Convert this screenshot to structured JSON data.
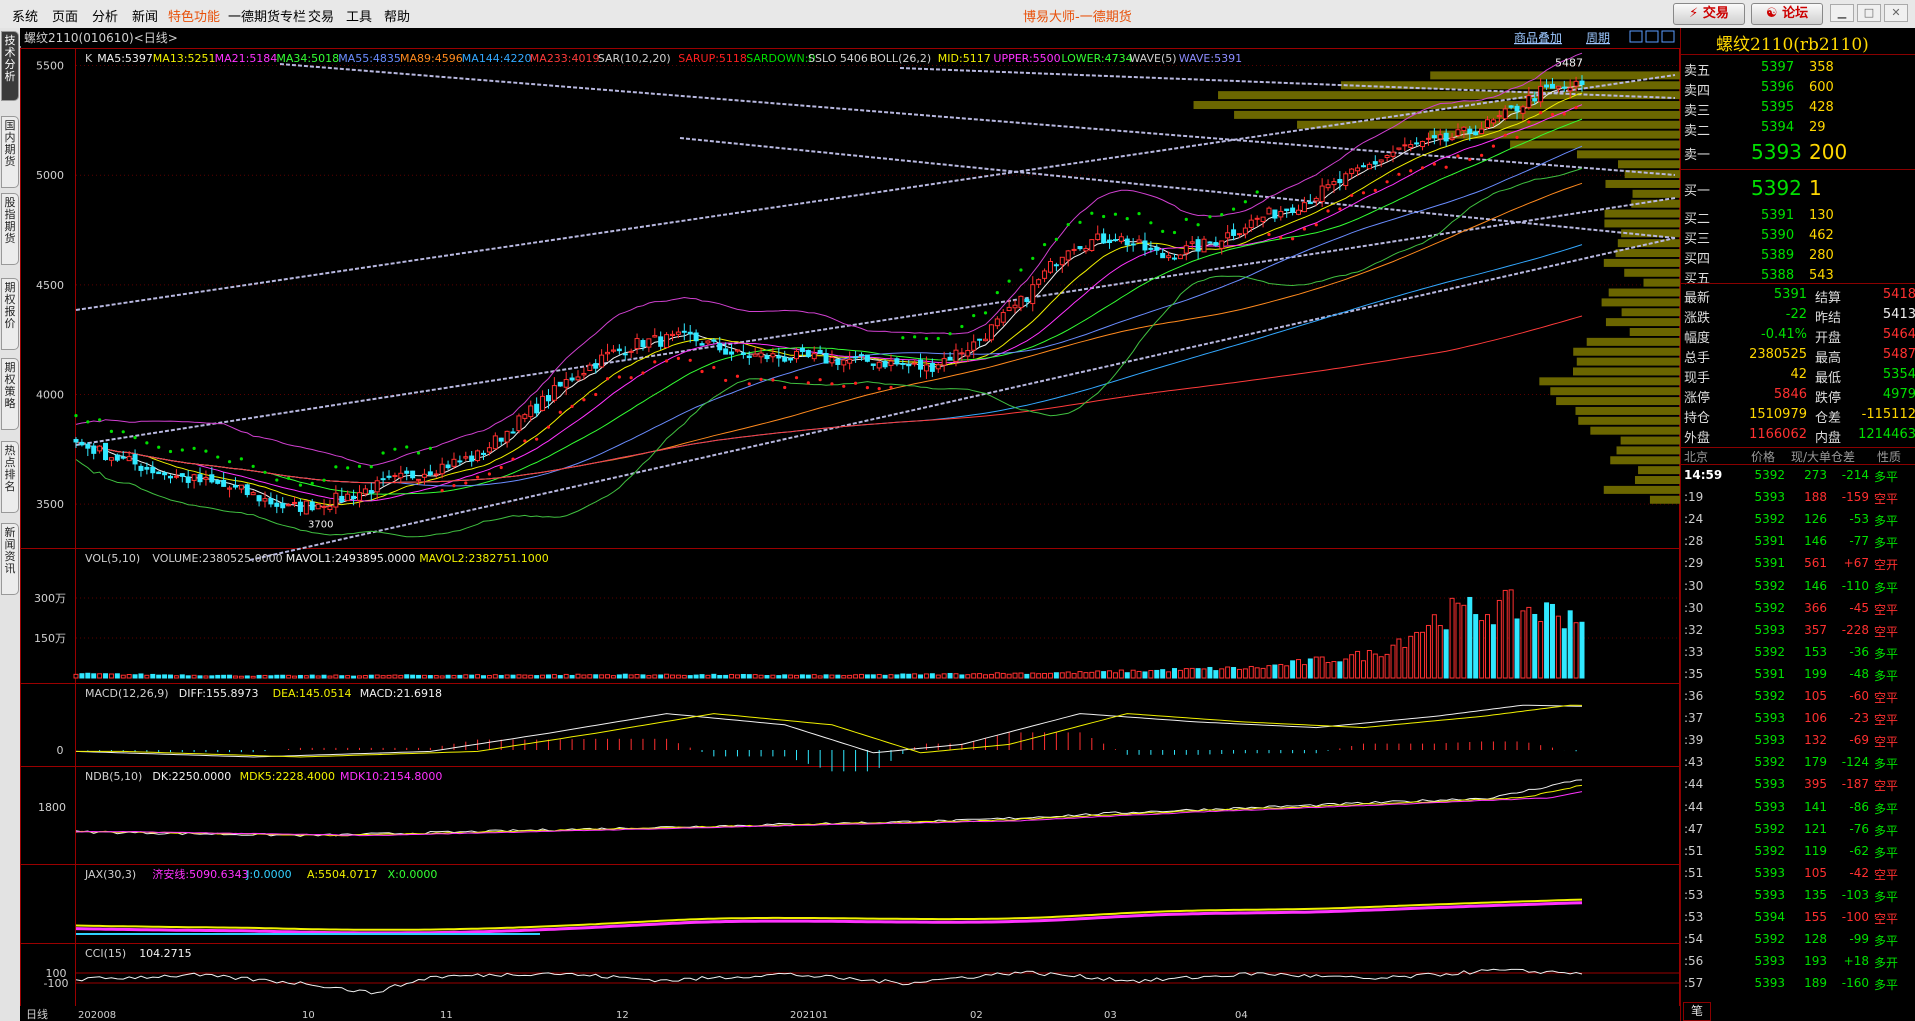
{
  "menu": {
    "items": [
      "系统",
      "页面",
      "分析",
      "新闻",
      "特色功能",
      "一德期货专栏",
      "交易",
      "工具",
      "帮助"
    ],
    "title": "博易大师-一德期货",
    "trade_button": "交易",
    "forum_button": "论坛"
  },
  "left_tabs": [
    "技术分析",
    "国内期货",
    "股指期货",
    "期权报价",
    "期权策略",
    "热点排名",
    "新闻资讯"
  ],
  "chart_header": {
    "instrument": "螺纹2110(010610)<日线>",
    "links": [
      "商品叠加",
      "周期"
    ]
  },
  "main_legend": [
    {
      "text": "K",
      "color": "#d0d0d0"
    },
    {
      "text": "MA5:5397",
      "color": "#f0f0f0"
    },
    {
      "text": "MA13:5251",
      "color": "#f0f000"
    },
    {
      "text": "MA21:5184",
      "color": "#ff33ff"
    },
    {
      "text": "MA34:5018",
      "color": "#33ff33"
    },
    {
      "text": "MA55:4835",
      "color": "#6a8cff"
    },
    {
      "text": "MA89:4596",
      "color": "#ff8a1e"
    },
    {
      "text": "MA144:4220",
      "color": "#33a8ff"
    },
    {
      "text": "MA233:4019",
      "color": "#ff3b3b"
    },
    {
      "text": "SAR(10,2,20)",
      "color": "#d0d0d0"
    },
    {
      "text": "SARUP:5118",
      "color": "#ff2020"
    },
    {
      "text": "SARDOWN:0",
      "color": "#00e000"
    },
    {
      "text": "SSLO 5406",
      "color": "#d0d0d0"
    },
    {
      "text": "BOLL(26,2)",
      "color": "#d0d0d0"
    },
    {
      "text": "MID:5117",
      "color": "#f0f000"
    },
    {
      "text": "UPPER:5500",
      "color": "#ff33ff"
    },
    {
      "text": "LOWER:4734",
      "color": "#33ff33"
    },
    {
      "text": "WAVE(5)",
      "color": "#d0d0d0"
    },
    {
      "text": "WAVE:5391",
      "color": "#8c8cff"
    }
  ],
  "price_axis": [
    "5500",
    "5000",
    "4500",
    "4000",
    "3500"
  ],
  "annotations": {
    "high_label": "5487",
    "low_label": "3700"
  },
  "sub_panels": {
    "vol": {
      "legend": [
        {
          "text": "VOL(5,10)",
          "color": "#d0d0d0"
        },
        {
          "text": "VOLUME:2380525.0000",
          "color": "#d0d0d0"
        },
        {
          "text": "MAVOL1:2493895.0000",
          "color": "#f0f0f0"
        },
        {
          "text": "MAVOL2:2382751.1000",
          "color": "#f0f000"
        }
      ],
      "axis": [
        "300万",
        "150万"
      ]
    },
    "macd": {
      "legend": [
        {
          "text": "MACD(12,26,9)",
          "color": "#d0d0d0"
        },
        {
          "text": "DIFF:155.8973",
          "color": "#f0f0f0"
        },
        {
          "text": "DEA:145.0514",
          "color": "#f0f000"
        },
        {
          "text": "MACD:21.6918",
          "color": "#f0f0f0"
        }
      ],
      "axis": [
        "0"
      ]
    },
    "ndb": {
      "legend": [
        {
          "text": "NDB(5,10)",
          "color": "#d0d0d0"
        },
        {
          "text": "DK:2250.0000",
          "color": "#f0f0f0"
        },
        {
          "text": "MDK5:2228.4000",
          "color": "#f0f000"
        },
        {
          "text": "MDK10:2154.8000",
          "color": "#ff33ff"
        }
      ],
      "axis": [
        "1800"
      ]
    },
    "jax": {
      "legend": [
        {
          "text": "JAX(30,3)",
          "color": "#d0d0d0"
        },
        {
          "text": "济安线:5090.6343",
          "color": "#ff33ff"
        },
        {
          "text": "J:0.0000",
          "color": "#33d0ff"
        },
        {
          "text": "A:5504.0717",
          "color": "#f0f000"
        },
        {
          "text": "X:0.0000",
          "color": "#33ff33"
        }
      ],
      "axis": []
    },
    "cci": {
      "legend": [
        {
          "text": "CCI(15)",
          "color": "#d0d0d0"
        },
        {
          "text": "104.2715",
          "color": "#f0f0f0"
        }
      ],
      "axis": [
        "100",
        "-100"
      ]
    }
  },
  "time_axis": {
    "label": "日线",
    "ticks": [
      "202008",
      "10",
      "11",
      "12",
      "202101",
      "02",
      "03",
      "04"
    ]
  },
  "right_panel": {
    "title": "螺纹2110(rb2110)",
    "asks": [
      {
        "label": "卖五",
        "price": "5397",
        "vol": "358"
      },
      {
        "label": "卖四",
        "price": "5396",
        "vol": "600"
      },
      {
        "label": "卖三",
        "price": "5395",
        "vol": "428"
      },
      {
        "label": "卖二",
        "price": "5394",
        "vol": "29"
      },
      {
        "label": "卖一",
        "price": "5393",
        "vol": "200"
      }
    ],
    "bids": [
      {
        "label": "买一",
        "price": "5392",
        "vol": "1"
      },
      {
        "label": "买二",
        "price": "5391",
        "vol": "130"
      },
      {
        "label": "买三",
        "price": "5390",
        "vol": "462"
      },
      {
        "label": "买四",
        "price": "5389",
        "vol": "280"
      },
      {
        "label": "买五",
        "price": "5388",
        "vol": "543"
      }
    ],
    "quote": [
      {
        "l1": "最新",
        "v1": "5391",
        "c1": "#00e000",
        "l2": "结算",
        "v2": "5418",
        "c2": "#ff3030"
      },
      {
        "l1": "涨跌",
        "v1": "-22",
        "c1": "#00e000",
        "l2": "昨结",
        "v2": "5413",
        "c2": "#f0f0f0"
      },
      {
        "l1": "幅度",
        "v1": "-0.41%",
        "c1": "#00e000",
        "l2": "开盘",
        "v2": "5464",
        "c2": "#ff3030"
      },
      {
        "l1": "总手",
        "v1": "2380525",
        "c1": "#ffd700",
        "l2": "最高",
        "v2": "5487",
        "c2": "#ff3030"
      },
      {
        "l1": "现手",
        "v1": "42",
        "c1": "#ffd700",
        "l2": "最低",
        "v2": "5354",
        "c2": "#00e000"
      },
      {
        "l1": "涨停",
        "v1": "5846",
        "c1": "#ff3030",
        "l2": "跌停",
        "v2": "4979",
        "c2": "#00e000"
      },
      {
        "l1": "持仓",
        "v1": "1510979",
        "c1": "#ffd700",
        "l2": "仓差",
        "v2": "-115112",
        "c2": "#ffd700"
      },
      {
        "l1": "外盘",
        "v1": "1166062",
        "c1": "#ff3030",
        "l2": "内盘",
        "v2": "1214463",
        "c2": "#00e000"
      }
    ],
    "ticks_header": [
      "北京",
      "价格",
      "现/大单",
      "仓差",
      "性质"
    ],
    "ticks": [
      {
        "t": "14:59",
        "p": "5392",
        "v": "273",
        "d": "-214",
        "n": "多平"
      },
      {
        "t": ":19",
        "p": "5393",
        "v": "188",
        "d": "-159",
        "n": "空平"
      },
      {
        "t": ":24",
        "p": "5392",
        "v": "126",
        "d": "-53",
        "n": "多平"
      },
      {
        "t": ":28",
        "p": "5391",
        "v": "146",
        "d": "-77",
        "n": "多平"
      },
      {
        "t": ":29",
        "p": "5391",
        "v": "561",
        "d": "+67",
        "n": "空开"
      },
      {
        "t": ":30",
        "p": "5392",
        "v": "146",
        "d": "-110",
        "n": "多平"
      },
      {
        "t": ":30",
        "p": "5392",
        "v": "366",
        "d": "-45",
        "n": "空平"
      },
      {
        "t": ":32",
        "p": "5393",
        "v": "357",
        "d": "-228",
        "n": "空平"
      },
      {
        "t": ":33",
        "p": "5392",
        "v": "153",
        "d": "-36",
        "n": "多平"
      },
      {
        "t": ":35",
        "p": "5391",
        "v": "199",
        "d": "-48",
        "n": "多平"
      },
      {
        "t": ":36",
        "p": "5392",
        "v": "105",
        "d": "-60",
        "n": "空平"
      },
      {
        "t": ":37",
        "p": "5393",
        "v": "106",
        "d": "-23",
        "n": "空平"
      },
      {
        "t": ":39",
        "p": "5393",
        "v": "132",
        "d": "-69",
        "n": "空平"
      },
      {
        "t": ":43",
        "p": "5392",
        "v": "179",
        "d": "-124",
        "n": "多平"
      },
      {
        "t": ":44",
        "p": "5393",
        "v": "395",
        "d": "-187",
        "n": "空平"
      },
      {
        "t": ":44",
        "p": "5393",
        "v": "141",
        "d": "-86",
        "n": "多平"
      },
      {
        "t": ":47",
        "p": "5392",
        "v": "121",
        "d": "-76",
        "n": "多平"
      },
      {
        "t": ":51",
        "p": "5392",
        "v": "119",
        "d": "-62",
        "n": "多平"
      },
      {
        "t": ":51",
        "p": "5393",
        "v": "105",
        "d": "-42",
        "n": "空平"
      },
      {
        "t": ":53",
        "p": "5393",
        "v": "135",
        "d": "-103",
        "n": "多平"
      },
      {
        "t": ":53",
        "p": "5394",
        "v": "155",
        "d": "-100",
        "n": "空平"
      },
      {
        "t": ":54",
        "p": "5392",
        "v": "128",
        "d": "-99",
        "n": "多平"
      },
      {
        "t": ":56",
        "p": "5393",
        "v": "193",
        "d": "+18",
        "n": "多开"
      },
      {
        "t": ":57",
        "p": "5393",
        "v": "189",
        "d": "-160",
        "n": "多平"
      }
    ],
    "bottom_tab": "笔"
  },
  "chart_data": {
    "type": "candlestick",
    "ylim": [
      3300,
      5580
    ],
    "x_ticks": [
      "202008",
      "10",
      "11",
      "12",
      "202101",
      "02",
      "03",
      "04"
    ],
    "anchors": [
      [
        0,
        3780
      ],
      [
        8,
        3700
      ],
      [
        16,
        3630
      ],
      [
        22,
        3600
      ],
      [
        28,
        3560
      ],
      [
        36,
        3480
      ],
      [
        44,
        3520
      ],
      [
        52,
        3590
      ],
      [
        60,
        3660
      ],
      [
        68,
        3720
      ],
      [
        76,
        3900
      ],
      [
        84,
        4080
      ],
      [
        90,
        4180
      ],
      [
        96,
        4240
      ],
      [
        104,
        4260
      ],
      [
        112,
        4180
      ],
      [
        120,
        4170
      ],
      [
        128,
        4160
      ],
      [
        136,
        4150
      ],
      [
        144,
        4120
      ],
      [
        152,
        4230
      ],
      [
        160,
        4420
      ],
      [
        168,
        4680
      ],
      [
        176,
        4720
      ],
      [
        184,
        4630
      ],
      [
        192,
        4690
      ],
      [
        200,
        4800
      ],
      [
        208,
        4880
      ],
      [
        216,
        5000
      ],
      [
        224,
        5120
      ],
      [
        232,
        5160
      ],
      [
        240,
        5240
      ],
      [
        248,
        5380
      ],
      [
        255,
        5410
      ]
    ],
    "volume_anchors": [
      [
        0,
        15
      ],
      [
        30,
        8
      ],
      [
        60,
        10
      ],
      [
        90,
        12
      ],
      [
        130,
        10
      ],
      [
        170,
        20
      ],
      [
        200,
        38
      ],
      [
        220,
        90
      ],
      [
        232,
        240
      ],
      [
        243,
        265
      ],
      [
        249,
        245
      ],
      [
        255,
        238
      ]
    ],
    "macd_anchors": [
      [
        0,
        -5
      ],
      [
        30,
        -25
      ],
      [
        60,
        -5
      ],
      [
        80,
        60
      ],
      [
        100,
        130
      ],
      [
        120,
        90
      ],
      [
        135,
        -10
      ],
      [
        150,
        20
      ],
      [
        170,
        130
      ],
      [
        190,
        100
      ],
      [
        210,
        80
      ],
      [
        230,
        120
      ],
      [
        245,
        160
      ],
      [
        255,
        156
      ]
    ],
    "ndb_anchors": [
      [
        0,
        1400
      ],
      [
        40,
        1340
      ],
      [
        80,
        1430
      ],
      [
        120,
        1520
      ],
      [
        150,
        1580
      ],
      [
        180,
        1720
      ],
      [
        210,
        1830
      ],
      [
        240,
        1950
      ],
      [
        255,
        2250
      ]
    ],
    "cci_anchors": [
      [
        0,
        -30
      ],
      [
        20,
        60
      ],
      [
        40,
        -120
      ],
      [
        50,
        -300
      ],
      [
        60,
        20
      ],
      [
        80,
        100
      ],
      [
        100,
        -50
      ],
      [
        120,
        80
      ],
      [
        140,
        -100
      ],
      [
        160,
        120
      ],
      [
        180,
        -60
      ],
      [
        200,
        90
      ],
      [
        220,
        -20
      ],
      [
        240,
        150
      ],
      [
        255,
        104
      ]
    ]
  }
}
